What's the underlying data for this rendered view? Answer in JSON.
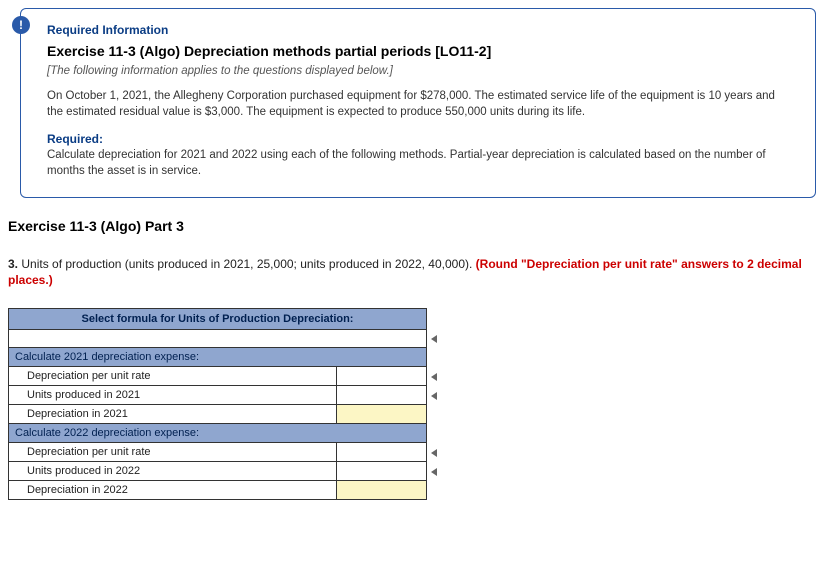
{
  "badge": "!",
  "info": {
    "heading": "Required Information",
    "title": "Exercise 11-3 (Algo) Depreciation methods partial periods [LO11-2]",
    "applies": "[The following information applies to the questions displayed below.]",
    "para": "On October 1, 2021, the Allegheny Corporation purchased equipment for $278,000. The estimated service life of the equipment is 10 years and the estimated residual value is $3,000. The equipment is expected to produce 550,000 units during its life.",
    "required_label": "Required:",
    "required_text": "Calculate depreciation for 2021 and 2022 using each of the following methods. Partial-year depreciation is calculated based on the number of months the asset is in service."
  },
  "part_heading": "Exercise 11-3 (Algo) Part 3",
  "question": {
    "num": "3.",
    "text": "Units of production (units produced in 2021, 25,000; units produced in 2022, 40,000). ",
    "round": "(Round \"Depreciation per unit rate\" answers to 2 decimal places.)"
  },
  "table": {
    "formula_header": "Select formula for Units of Production Depreciation:",
    "sec2021": "Calculate 2021 depreciation expense:",
    "r2021_rate": "Depreciation per unit rate",
    "r2021_units": "Units produced in 2021",
    "r2021_dep": "Depreciation in 2021",
    "sec2022": "Calculate 2022 depreciation expense:",
    "r2022_rate": "Depreciation per unit rate",
    "r2022_units": "Units produced in 2022",
    "r2022_dep": "Depreciation in 2022"
  }
}
